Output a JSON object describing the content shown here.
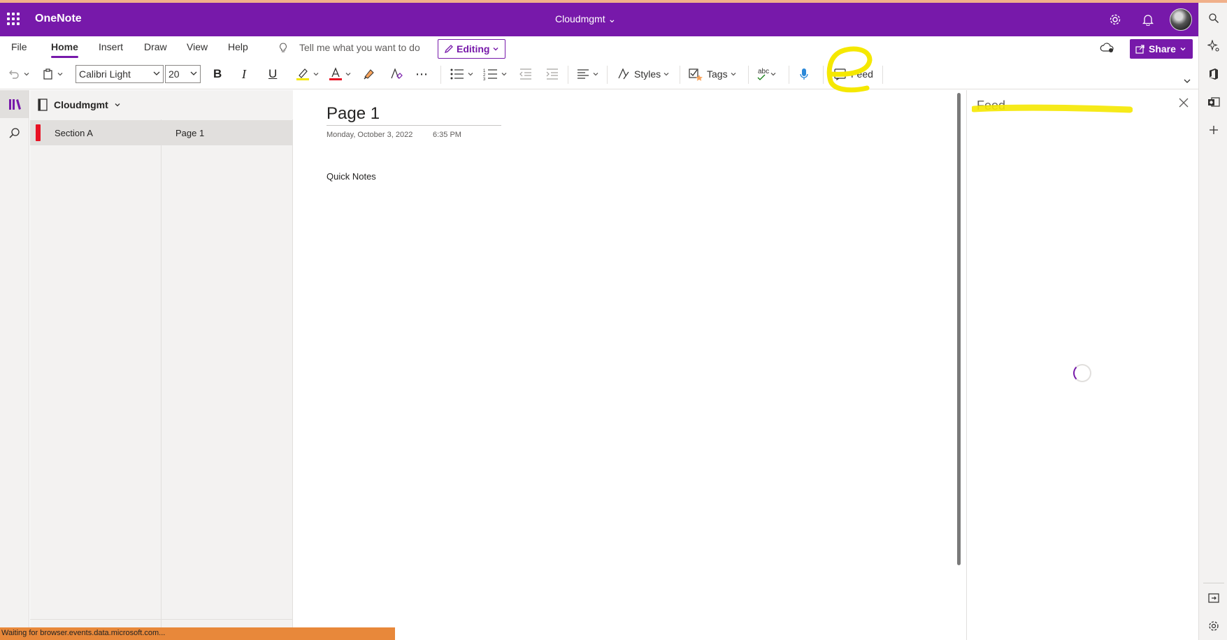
{
  "titlebar": {
    "app_name": "OneNote",
    "notebook_title": "Cloudmgmt ⌄",
    "accent_color": "#7719aa"
  },
  "menu": {
    "items": [
      "File",
      "Home",
      "Insert",
      "Draw",
      "View",
      "Help"
    ],
    "active": "Home",
    "tell_me_placeholder": "Tell me what you want to do",
    "editing_label": "Editing",
    "share_label": "Share"
  },
  "ribbon": {
    "font_family": "Calibri Light",
    "font_size": "20",
    "styles_label": "Styles",
    "tags_label": "Tags",
    "feed_label": "Feed",
    "spell_label": "abc"
  },
  "navigation": {
    "notebook_name": "Cloudmgmt",
    "sections": [
      {
        "label": "Section A",
        "color": "#e81123"
      }
    ],
    "pages": [
      {
        "label": "Page 1"
      }
    ]
  },
  "page": {
    "title": "Page 1",
    "date": "Monday, October 3, 2022",
    "time": "6:35 PM",
    "content": "Quick Notes"
  },
  "feed_pane": {
    "title": "Feed",
    "loading": true
  },
  "status_bar": {
    "text": "Waiting for browser.events.data.microsoft.com..."
  },
  "annotations": {
    "highlight_color": "#f5e800"
  }
}
